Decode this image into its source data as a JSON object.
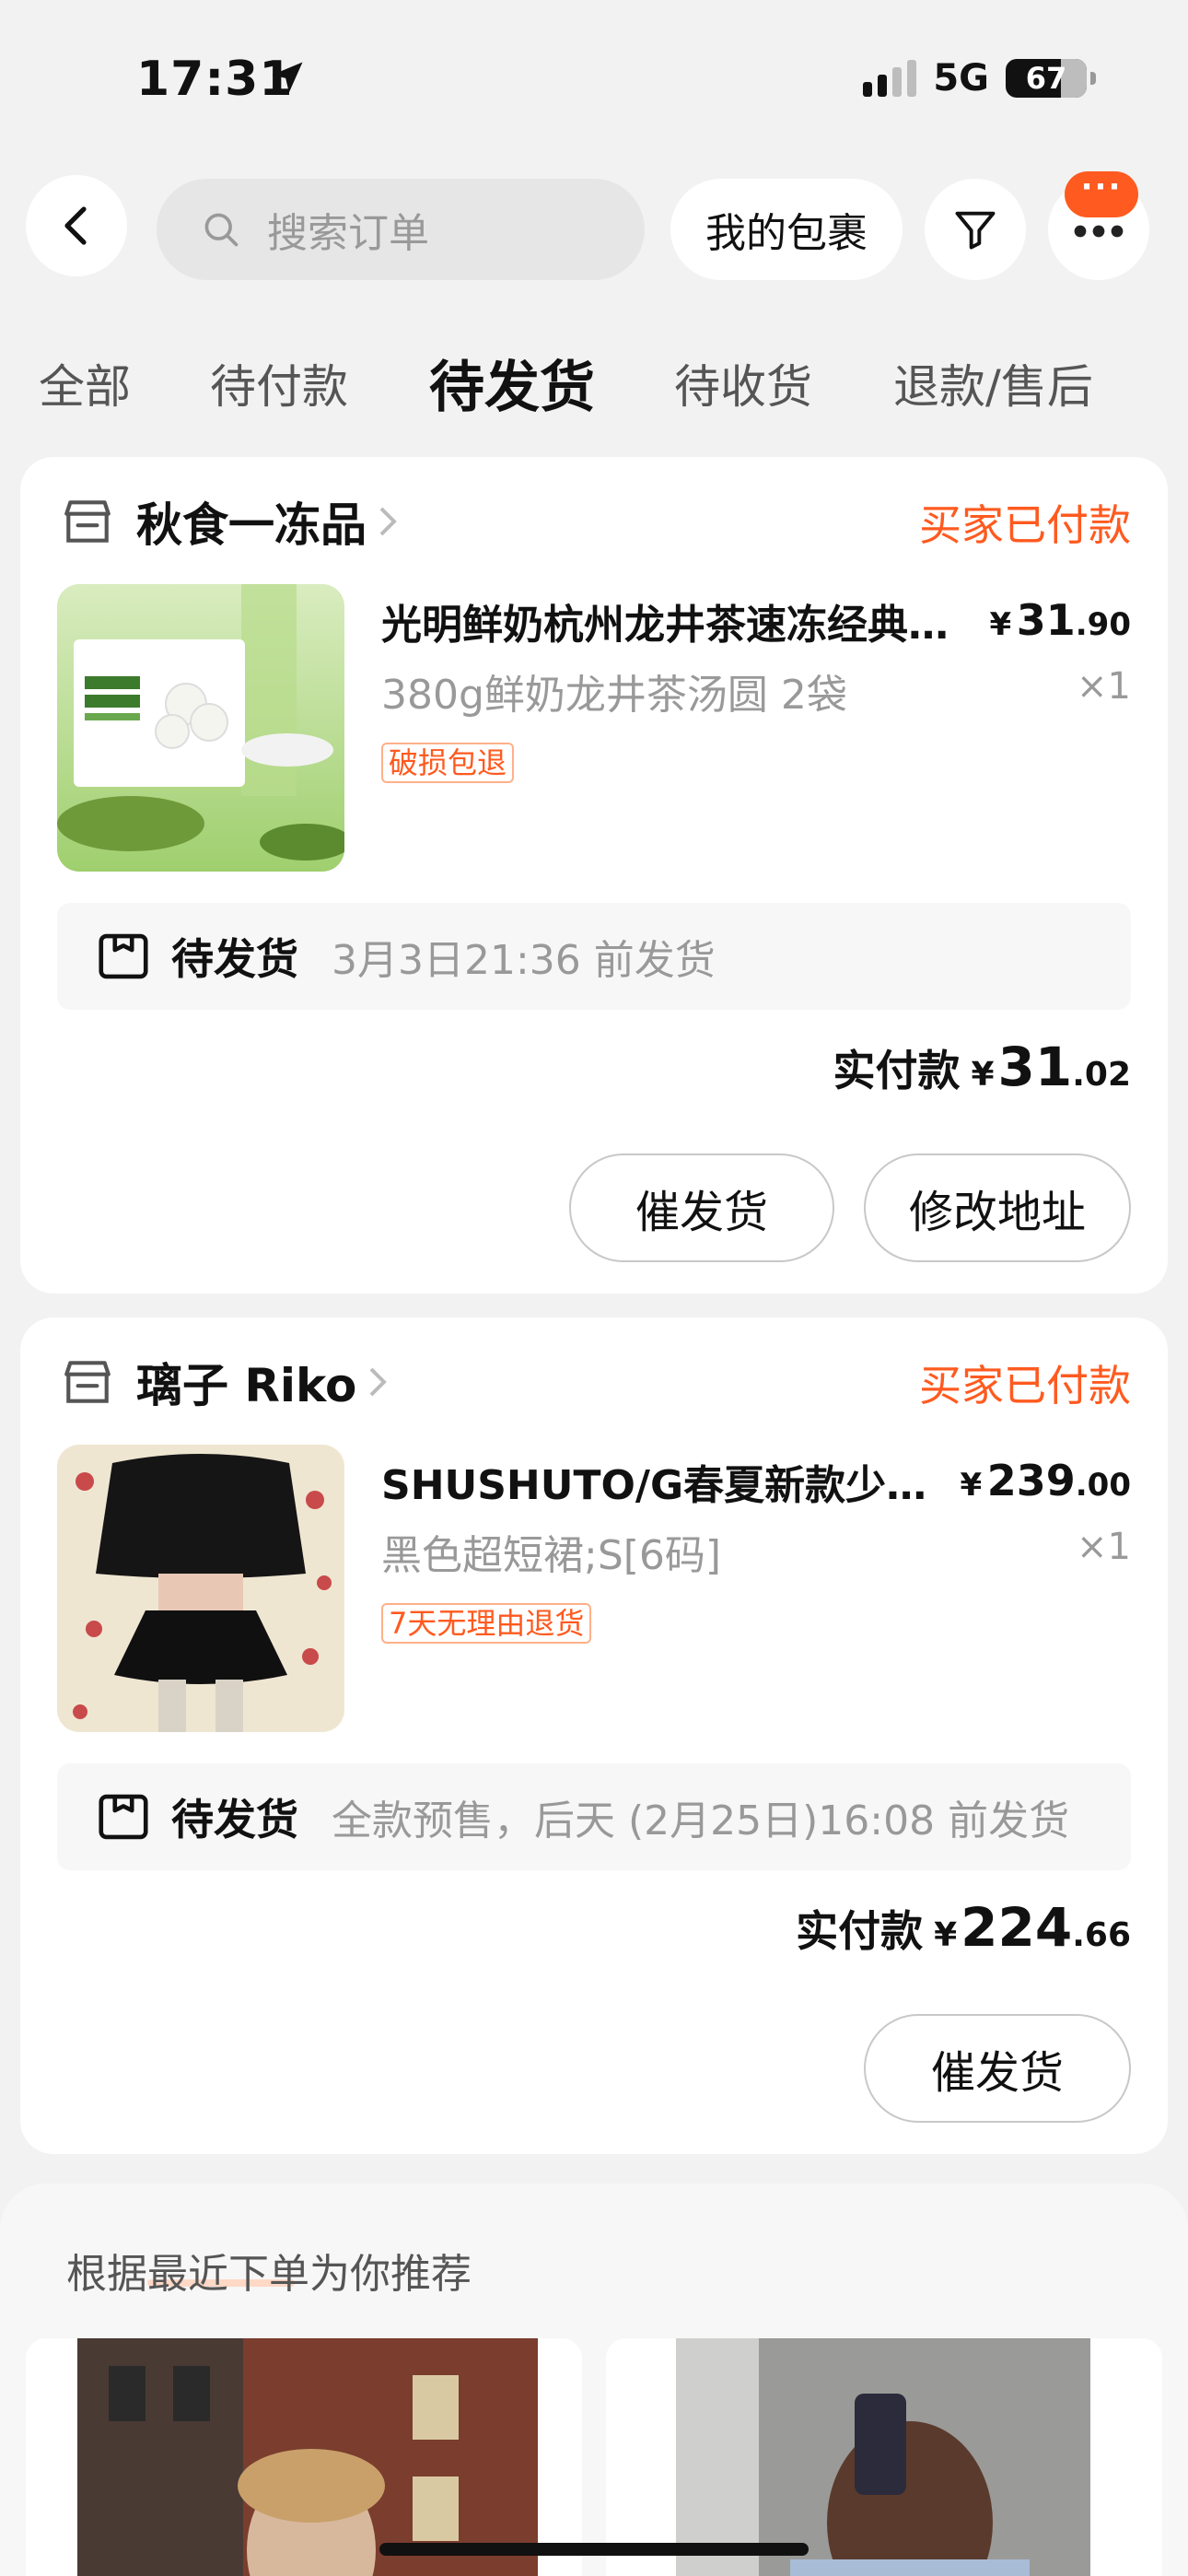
{
  "status_bar": {
    "time": "17:31",
    "network": "5G",
    "battery": "67"
  },
  "header": {
    "search_placeholder": "搜索订单",
    "packages_label": "我的包裹",
    "more_badge": "···"
  },
  "tabs": [
    {
      "label": "全部"
    },
    {
      "label": "待付款"
    },
    {
      "label": "待发货",
      "active": true
    },
    {
      "label": "待收货"
    },
    {
      "label": "退款/售后"
    }
  ],
  "orders": [
    {
      "shop": "秋食一冻品",
      "status": "买家已付款",
      "title": "光明鲜奶杭州龙井茶速冻经典汤圆",
      "spec": "380g鲜奶龙井茶汤圆 2袋",
      "price_cur": "¥",
      "price_int": "31",
      "price_dec": ".90",
      "qty": "×1",
      "tag": "破损包退",
      "ship_label": "待发货",
      "ship_desc": "3月3日21:36 前发货",
      "paid_label": "实付款",
      "paid_cur": "¥",
      "paid_int": "31",
      "paid_dec": ".02",
      "buttons": [
        "催发货",
        "修改地址"
      ]
    },
    {
      "shop": "璃子 Riko",
      "status": "买家已付款",
      "title": "SHUSHUTO/G春夏新款少女风短裙",
      "spec": "黑色超短裙;S[6码]",
      "price_cur": "¥",
      "price_int": "239",
      "price_dec": ".00",
      "qty": "×1",
      "tag": "7天无理由退货",
      "ship_label": "待发货",
      "ship_desc": "全款预售，后天 (2月25日)16:08 前发货",
      "paid_label": "实付款",
      "paid_cur": "¥",
      "paid_int": "224",
      "paid_dec": ".66",
      "buttons": [
        "催发货"
      ]
    }
  ],
  "recommend": {
    "title": "根据最近下单为你推荐"
  },
  "colors": {
    "accent": "#ff5a1f",
    "background": "#f2f2f2"
  },
  "icons": [
    "location-arrow-icon",
    "back-chevron-icon",
    "search-icon",
    "filter-icon",
    "more-dots-icon",
    "store-icon",
    "chevron-right-icon",
    "box-icon"
  ]
}
